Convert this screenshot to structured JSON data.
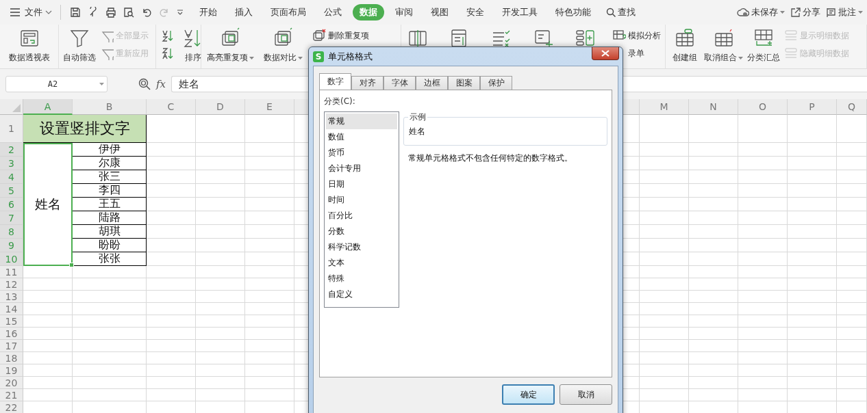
{
  "menubar": {
    "file_menu": "文件",
    "tabs": [
      {
        "label": "开始",
        "selected": false
      },
      {
        "label": "插入",
        "selected": false
      },
      {
        "label": "页面布局",
        "selected": false
      },
      {
        "label": "公式",
        "selected": false
      },
      {
        "label": "数据",
        "selected": true
      },
      {
        "label": "审阅",
        "selected": false
      },
      {
        "label": "视图",
        "selected": false
      },
      {
        "label": "安全",
        "selected": false
      },
      {
        "label": "开发工具",
        "selected": false
      },
      {
        "label": "特色功能",
        "selected": false
      }
    ],
    "search": "查找",
    "right": [
      {
        "label": "未保存",
        "kind": "cloud"
      },
      {
        "label": "分享",
        "kind": "share"
      },
      {
        "label": "批注",
        "kind": "comment"
      }
    ]
  },
  "ribbon": {
    "groups": [
      {
        "items": [
          {
            "kind": "big",
            "label": "数据透视表"
          }
        ]
      },
      {
        "items": [
          {
            "kind": "big",
            "label": "自动筛选"
          },
          {
            "kind": "stack",
            "items": [
              {
                "label": "全部显示",
                "disabled": true
              },
              {
                "label": "重新应用",
                "disabled": true
              }
            ]
          }
        ]
      },
      {
        "items": [
          {
            "kind": "stack",
            "items": [
              {
                "disabled": false
              },
              {
                "disabled": false
              }
            ]
          },
          {
            "kind": "big",
            "label": "排序"
          }
        ]
      },
      {
        "items": [
          {
            "kind": "big",
            "label": "高亮重复项",
            "dropdown": true
          },
          {
            "kind": "big",
            "label": "数据对比",
            "dropdown": true
          },
          {
            "kind": "stack",
            "items": [
              {
                "label": "删除重复项",
                "disabled": false
              }
            ]
          }
        ]
      },
      {
        "items": [
          {
            "kind": "tool"
          },
          {
            "kind": "tool"
          },
          {
            "kind": "tool"
          },
          {
            "kind": "tool"
          },
          {
            "kind": "tool"
          },
          {
            "kind": "stack",
            "items": [
              {
                "label": "模拟分析",
                "disabled": false
              },
              {
                "label": "录单",
                "disabled": false
              }
            ]
          }
        ]
      },
      {
        "items": [
          {
            "kind": "big",
            "label": "创建组"
          },
          {
            "kind": "big",
            "label": "取消组合",
            "dropdown": true
          },
          {
            "kind": "big",
            "label": "分类汇总"
          },
          {
            "kind": "stack",
            "items": [
              {
                "label": "显示明细数据",
                "disabled": true
              },
              {
                "label": "隐藏明细数据",
                "disabled": true
              }
            ]
          }
        ]
      }
    ]
  },
  "sheet": {
    "name_box": "A2",
    "fx": "fx",
    "formula": "姓名",
    "columns": [
      {
        "label": "A",
        "selected": true
      },
      {
        "label": "B",
        "selected": false
      },
      {
        "label": "C",
        "selected": false
      },
      {
        "label": "D",
        "selected": false
      },
      {
        "label": "E",
        "selected": false
      },
      {
        "label": "M",
        "selected": false
      },
      {
        "label": "N",
        "selected": false
      },
      {
        "label": "O",
        "selected": false
      },
      {
        "label": "P",
        "selected": false
      },
      {
        "label": "Q",
        "selected": false
      }
    ],
    "rows": [
      {
        "label": "1",
        "selected": false
      },
      {
        "label": "2",
        "selected": true
      },
      {
        "label": "3",
        "selected": true
      },
      {
        "label": "4",
        "selected": true
      },
      {
        "label": "5",
        "selected": true
      },
      {
        "label": "6",
        "selected": true
      },
      {
        "label": "7",
        "selected": true
      },
      {
        "label": "8",
        "selected": true
      },
      {
        "label": "9",
        "selected": true
      },
      {
        "label": "10",
        "selected": true
      },
      {
        "label": "11",
        "selected": false
      },
      {
        "label": "12",
        "selected": false
      },
      {
        "label": "13",
        "selected": false
      },
      {
        "label": "14",
        "selected": false
      },
      {
        "label": "15",
        "selected": false
      },
      {
        "label": "16",
        "selected": false
      },
      {
        "label": "17",
        "selected": false
      },
      {
        "label": "18",
        "selected": false
      },
      {
        "label": "19",
        "selected": false
      },
      {
        "label": "20",
        "selected": false
      },
      {
        "label": "21",
        "selected": false
      },
      {
        "label": "22",
        "selected": false
      }
    ],
    "title": "设置竖排文字",
    "merged_cell": {
      "text": "姓名",
      "selected": true
    },
    "names": [
      "伊伊",
      "尔康",
      "张三",
      "李四",
      "王五",
      "陆路",
      "胡琪",
      "盼盼",
      "张张"
    ]
  },
  "dialog": {
    "app_icon": "S",
    "title": "单元格格式",
    "tabs": [
      {
        "label": "数字",
        "selected": true
      },
      {
        "label": "对齐",
        "selected": false
      },
      {
        "label": "字体",
        "selected": false
      },
      {
        "label": "边框",
        "selected": false
      },
      {
        "label": "图案",
        "selected": false
      },
      {
        "label": "保护",
        "selected": false
      }
    ],
    "category_label": "分类(C):",
    "categories": [
      {
        "label": "常规",
        "selected": true
      },
      {
        "label": "数值",
        "selected": false
      },
      {
        "label": "货币",
        "selected": false
      },
      {
        "label": "会计专用",
        "selected": false
      },
      {
        "label": "日期",
        "selected": false
      },
      {
        "label": "时间",
        "selected": false
      },
      {
        "label": "百分比",
        "selected": false
      },
      {
        "label": "分数",
        "selected": false
      },
      {
        "label": "科学记数",
        "selected": false
      },
      {
        "label": "文本",
        "selected": false
      },
      {
        "label": "特殊",
        "selected": false
      },
      {
        "label": "自定义",
        "selected": false
      }
    ],
    "sample_legend": "示例",
    "sample_value": "姓名",
    "description": "常规单元格格式不包含任何特定的数字格式。",
    "buttons": [
      {
        "label": "确定",
        "kind": "default"
      },
      {
        "label": "取消",
        "kind": "normal"
      }
    ]
  }
}
